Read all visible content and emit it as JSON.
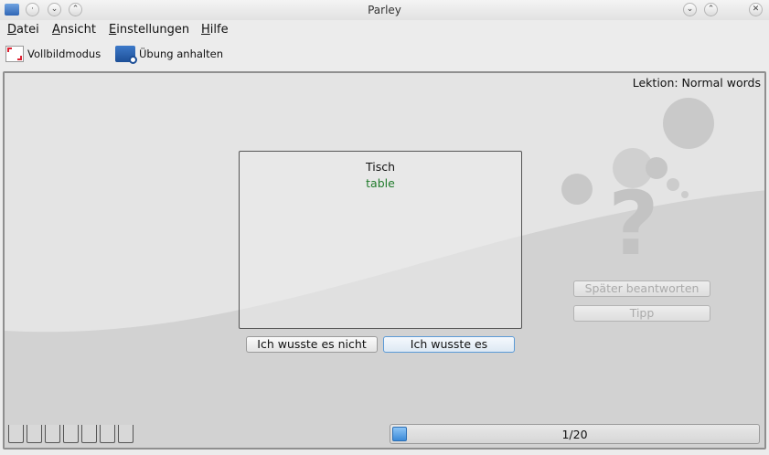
{
  "window": {
    "title": "Parley",
    "controls": [
      "minimize-icon",
      "maximize-icon",
      "close-icon"
    ]
  },
  "menubar": {
    "items": [
      {
        "accel": "D",
        "rest": "atei"
      },
      {
        "accel": "A",
        "rest": "nsicht"
      },
      {
        "accel": "E",
        "rest": "instellungen"
      },
      {
        "accel": "H",
        "rest": "ilfe"
      }
    ]
  },
  "toolbar": {
    "fullscreen_label": "Vollbildmodus",
    "pause_label": "Übung anhalten"
  },
  "practice": {
    "lesson_label": "Lektion: Normal words",
    "question": "Tisch",
    "answer": "table",
    "answer_color": "#1f7a2a",
    "btn_not_known": "Ich wusste es nicht",
    "btn_known": "Ich wusste es",
    "btn_later": "Später beantworten",
    "btn_hint": "Tipp",
    "box_count": 7,
    "progress_text": "1/20",
    "progress_fraction": 0.05
  }
}
